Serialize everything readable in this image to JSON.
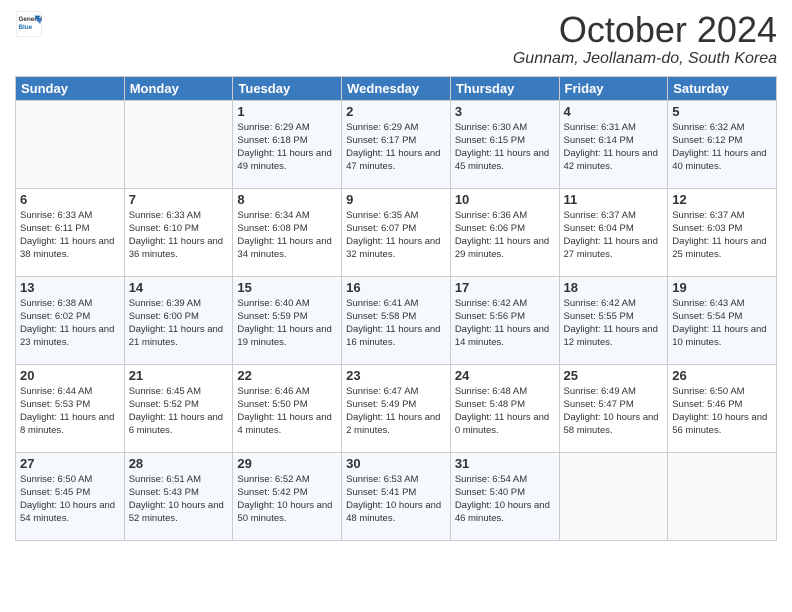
{
  "logo": {
    "line1": "General",
    "line2": "Blue"
  },
  "title": "October 2024",
  "subtitle": "Gunnam, Jeollanam-do, South Korea",
  "days_of_week": [
    "Sunday",
    "Monday",
    "Tuesday",
    "Wednesday",
    "Thursday",
    "Friday",
    "Saturday"
  ],
  "weeks": [
    [
      {
        "day": "",
        "info": ""
      },
      {
        "day": "",
        "info": ""
      },
      {
        "day": "1",
        "sunrise": "6:29 AM",
        "sunset": "6:18 PM",
        "daylight": "11 hours and 49 minutes."
      },
      {
        "day": "2",
        "sunrise": "6:29 AM",
        "sunset": "6:17 PM",
        "daylight": "11 hours and 47 minutes."
      },
      {
        "day": "3",
        "sunrise": "6:30 AM",
        "sunset": "6:15 PM",
        "daylight": "11 hours and 45 minutes."
      },
      {
        "day": "4",
        "sunrise": "6:31 AM",
        "sunset": "6:14 PM",
        "daylight": "11 hours and 42 minutes."
      },
      {
        "day": "5",
        "sunrise": "6:32 AM",
        "sunset": "6:12 PM",
        "daylight": "11 hours and 40 minutes."
      }
    ],
    [
      {
        "day": "6",
        "sunrise": "6:33 AM",
        "sunset": "6:11 PM",
        "daylight": "11 hours and 38 minutes."
      },
      {
        "day": "7",
        "sunrise": "6:33 AM",
        "sunset": "6:10 PM",
        "daylight": "11 hours and 36 minutes."
      },
      {
        "day": "8",
        "sunrise": "6:34 AM",
        "sunset": "6:08 PM",
        "daylight": "11 hours and 34 minutes."
      },
      {
        "day": "9",
        "sunrise": "6:35 AM",
        "sunset": "6:07 PM",
        "daylight": "11 hours and 32 minutes."
      },
      {
        "day": "10",
        "sunrise": "6:36 AM",
        "sunset": "6:06 PM",
        "daylight": "11 hours and 29 minutes."
      },
      {
        "day": "11",
        "sunrise": "6:37 AM",
        "sunset": "6:04 PM",
        "daylight": "11 hours and 27 minutes."
      },
      {
        "day": "12",
        "sunrise": "6:37 AM",
        "sunset": "6:03 PM",
        "daylight": "11 hours and 25 minutes."
      }
    ],
    [
      {
        "day": "13",
        "sunrise": "6:38 AM",
        "sunset": "6:02 PM",
        "daylight": "11 hours and 23 minutes."
      },
      {
        "day": "14",
        "sunrise": "6:39 AM",
        "sunset": "6:00 PM",
        "daylight": "11 hours and 21 minutes."
      },
      {
        "day": "15",
        "sunrise": "6:40 AM",
        "sunset": "5:59 PM",
        "daylight": "11 hours and 19 minutes."
      },
      {
        "day": "16",
        "sunrise": "6:41 AM",
        "sunset": "5:58 PM",
        "daylight": "11 hours and 16 minutes."
      },
      {
        "day": "17",
        "sunrise": "6:42 AM",
        "sunset": "5:56 PM",
        "daylight": "11 hours and 14 minutes."
      },
      {
        "day": "18",
        "sunrise": "6:42 AM",
        "sunset": "5:55 PM",
        "daylight": "11 hours and 12 minutes."
      },
      {
        "day": "19",
        "sunrise": "6:43 AM",
        "sunset": "5:54 PM",
        "daylight": "11 hours and 10 minutes."
      }
    ],
    [
      {
        "day": "20",
        "sunrise": "6:44 AM",
        "sunset": "5:53 PM",
        "daylight": "11 hours and 8 minutes."
      },
      {
        "day": "21",
        "sunrise": "6:45 AM",
        "sunset": "5:52 PM",
        "daylight": "11 hours and 6 minutes."
      },
      {
        "day": "22",
        "sunrise": "6:46 AM",
        "sunset": "5:50 PM",
        "daylight": "11 hours and 4 minutes."
      },
      {
        "day": "23",
        "sunrise": "6:47 AM",
        "sunset": "5:49 PM",
        "daylight": "11 hours and 2 minutes."
      },
      {
        "day": "24",
        "sunrise": "6:48 AM",
        "sunset": "5:48 PM",
        "daylight": "11 hours and 0 minutes."
      },
      {
        "day": "25",
        "sunrise": "6:49 AM",
        "sunset": "5:47 PM",
        "daylight": "10 hours and 58 minutes."
      },
      {
        "day": "26",
        "sunrise": "6:50 AM",
        "sunset": "5:46 PM",
        "daylight": "10 hours and 56 minutes."
      }
    ],
    [
      {
        "day": "27",
        "sunrise": "6:50 AM",
        "sunset": "5:45 PM",
        "daylight": "10 hours and 54 minutes."
      },
      {
        "day": "28",
        "sunrise": "6:51 AM",
        "sunset": "5:43 PM",
        "daylight": "10 hours and 52 minutes."
      },
      {
        "day": "29",
        "sunrise": "6:52 AM",
        "sunset": "5:42 PM",
        "daylight": "10 hours and 50 minutes."
      },
      {
        "day": "30",
        "sunrise": "6:53 AM",
        "sunset": "5:41 PM",
        "daylight": "10 hours and 48 minutes."
      },
      {
        "day": "31",
        "sunrise": "6:54 AM",
        "sunset": "5:40 PM",
        "daylight": "10 hours and 46 minutes."
      },
      {
        "day": "",
        "info": ""
      },
      {
        "day": "",
        "info": ""
      }
    ]
  ]
}
